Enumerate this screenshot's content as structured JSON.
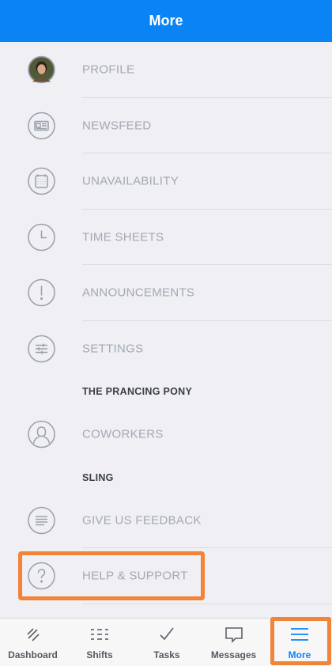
{
  "header": {
    "title": "More"
  },
  "menu": {
    "profile": "PROFILE",
    "newsfeed": "NEWSFEED",
    "unavailability": "UNAVAILABILITY",
    "timesheets": "TIME SHEETS",
    "announcements": "ANNOUNCEMENTS",
    "settings": "SETTINGS",
    "section_org": "THE PRANCING PONY",
    "coworkers": "COWORKERS",
    "section_app": "SLING",
    "feedback": "GIVE US FEEDBACK",
    "help": "HELP & SUPPORT"
  },
  "tabs": {
    "dashboard": "Dashboard",
    "shifts": "Shifts",
    "tasks": "Tasks",
    "messages": "Messages",
    "more": "More"
  },
  "colors": {
    "accent": "#0a84f5",
    "highlight": "#f2843a",
    "icon": "#9aa0aa",
    "label": "#a3a9b3"
  },
  "icons": {
    "profile": "avatar",
    "newsfeed": "newspaper-icon",
    "unavailability": "calendar-icon",
    "timesheets": "clock-icon",
    "announcements": "exclamation-icon",
    "settings": "sliders-icon",
    "coworkers": "person-icon",
    "feedback": "lines-icon",
    "help": "question-icon"
  }
}
